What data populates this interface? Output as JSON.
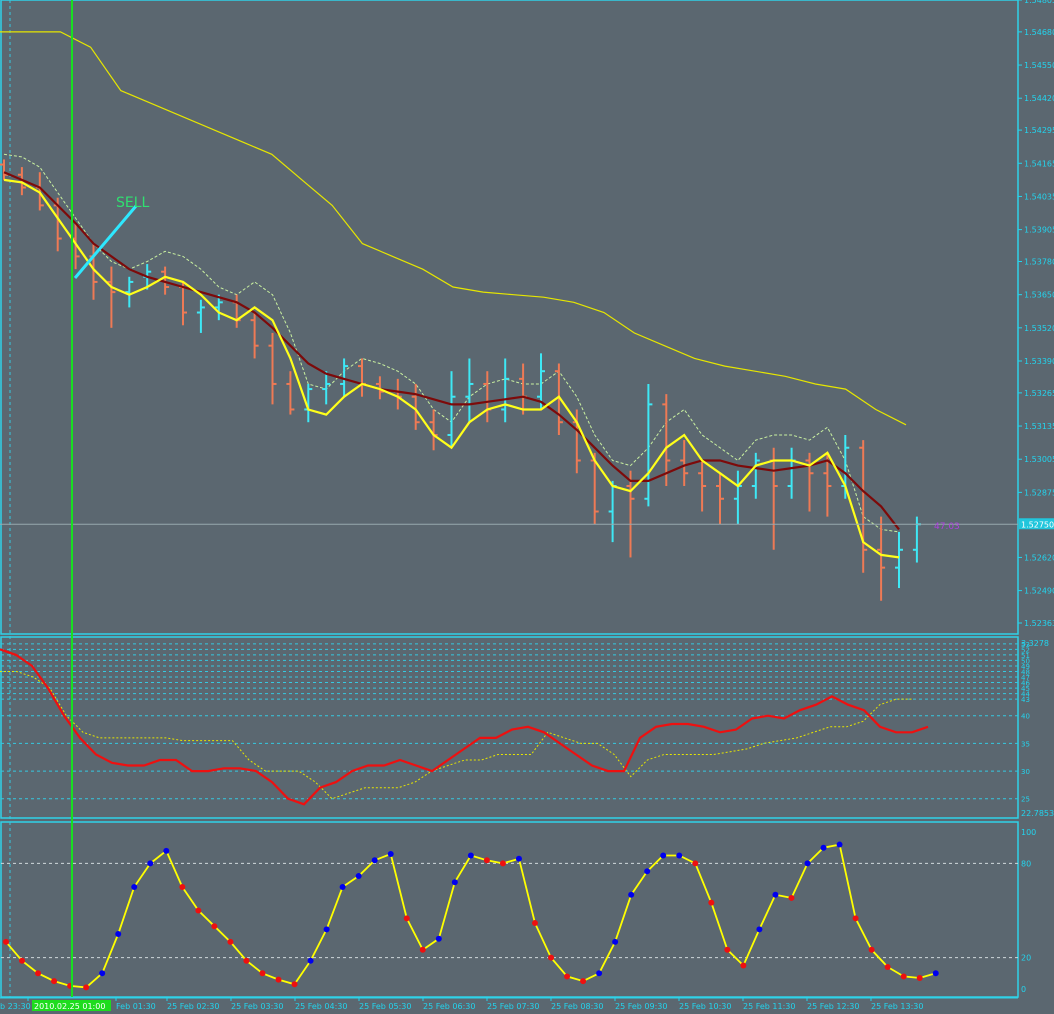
{
  "colors": {
    "background": "#5b6770",
    "panel_border": "#2fd2e8",
    "grid": "#35c8e0",
    "axis_text": "#23d4ee",
    "bull_bar": "#3ee8f5",
    "bear_bar": "#ee7a55",
    "fast_ma": "#ffff1a",
    "slow_ma": "#7d0a0a",
    "band": "#e6e600",
    "band_dotted": "#c9f0a0",
    "signal_text": "#30e070",
    "signal_line": "#2ee8ff",
    "cursor_line": "#18e020",
    "price_line": "#98a8ae",
    "price_label_bg": "#21c6dc",
    "adx_main": "#ee1010",
    "adx_dotted": "#e6e600",
    "stoch_line": "#ffff00",
    "stoch_dot_up": "#0000ee",
    "stoch_dot_down": "#ee1010",
    "time_highlight_bg": "#1edc1e",
    "annotation": "#b040e0"
  },
  "signal": {
    "label": "SELL"
  },
  "current_price": {
    "label": "1.52750",
    "annotation": "47.03"
  },
  "price_axis": {
    "ticks": [
      "1.54805",
      "1.54680",
      "1.54550",
      "1.54420",
      "1.54295",
      "1.54165",
      "1.54035",
      "1.53905",
      "1.53780",
      "1.53650",
      "1.53520",
      "1.53390",
      "1.53265",
      "1.53135",
      "1.53005",
      "1.52875",
      "1.52620",
      "1.52490",
      "1.52363"
    ]
  },
  "adx_axis": {
    "top_label": "3.3278",
    "ticks": [
      "53",
      "52",
      "51",
      "50",
      "49",
      "48",
      "47",
      "46",
      "45",
      "44",
      "43",
      "40",
      "35",
      "30",
      "25"
    ],
    "bottom_label": "22.7853"
  },
  "stoch_axis": {
    "ticks": [
      "100",
      "80",
      "20",
      "0"
    ]
  },
  "time_axis": {
    "highlight": "2010.02.25 01:00",
    "labels": [
      "b 23:30",
      "Feb 01:30",
      "25 Feb 02:30",
      "25 Feb 03:30",
      "25 Feb 04:30",
      "25 Feb 05:30",
      "25 Feb 06:30",
      "25 Feb 07:30",
      "25 Feb 08:30",
      "25 Feb 09:30",
      "25 Feb 10:30",
      "25 Feb 11:30",
      "25 Feb 12:30",
      "25 Feb 13:30"
    ]
  },
  "chart_data": [
    {
      "type": "line",
      "title": "Price",
      "ylim": [
        1.52363,
        1.54805
      ],
      "series": [
        {
          "values": [
            1.541,
            1.5409,
            1.5405,
            1.5395,
            1.5385,
            1.5375,
            1.5368,
            1.5365,
            1.5368,
            1.5372,
            1.537,
            1.5365,
            1.5358,
            1.5355,
            1.536,
            1.5355,
            1.534,
            1.532,
            1.5318,
            1.5325,
            1.533,
            1.5328,
            1.5325,
            1.532,
            1.531,
            1.5305,
            1.5315,
            1.532,
            1.5322,
            1.532,
            1.532,
            1.5325,
            1.5315,
            1.53,
            1.529,
            1.5288,
            1.5295,
            1.5305,
            1.531,
            1.53,
            1.5295,
            1.529,
            1.5298,
            1.53,
            1.53,
            1.5298,
            1.5303,
            1.529,
            1.5268,
            1.5263,
            1.5262
          ]
        },
        {
          "values": [
            1.5413,
            1.541,
            1.5407,
            1.54,
            1.5393,
            1.5385,
            1.538,
            1.5375,
            1.5372,
            1.537,
            1.5368,
            1.5366,
            1.5364,
            1.5362,
            1.5358,
            1.5352,
            1.5345,
            1.5338,
            1.5334,
            1.5332,
            1.533,
            1.5328,
            1.5327,
            1.5326,
            1.5324,
            1.5322,
            1.5322,
            1.5323,
            1.5324,
            1.5325,
            1.5323,
            1.5318,
            1.5312,
            1.5305,
            1.5298,
            1.5292,
            1.5292,
            1.5295,
            1.5298,
            1.53,
            1.53,
            1.5298,
            1.5297,
            1.5296,
            1.5297,
            1.5298,
            1.53,
            1.5295,
            1.5288,
            1.5282,
            1.5273
          ]
        },
        {
          "values": [
            1.5468,
            1.5468,
            1.5468,
            1.5462,
            1.5445,
            1.544,
            1.5435,
            1.543,
            1.5425,
            1.542,
            1.541,
            1.54,
            1.5385,
            1.538,
            1.5375,
            1.5368,
            1.5366,
            1.5365,
            1.5364,
            1.5362,
            1.5358,
            1.535,
            1.5345,
            1.534,
            1.5337,
            1.5335,
            1.5333,
            1.533,
            1.5328,
            1.532,
            1.5314
          ]
        }
      ],
      "bars": [
        [
          1.5416,
          1.5418,
          1.541,
          1.5412
        ],
        [
          1.5412,
          1.5415,
          1.5404,
          1.5407
        ],
        [
          1.5407,
          1.5413,
          1.5398,
          1.54
        ],
        [
          1.54,
          1.5403,
          1.5382,
          1.5387
        ],
        [
          1.5387,
          1.5393,
          1.5375,
          1.538
        ],
        [
          1.538,
          1.5385,
          1.5363,
          1.537
        ],
        [
          1.537,
          1.5376,
          1.5352,
          1.5366
        ],
        [
          1.5366,
          1.5372,
          1.536,
          1.537
        ],
        [
          1.5372,
          1.5377,
          1.5367,
          1.5374
        ],
        [
          1.5374,
          1.5376,
          1.5365,
          1.5368
        ],
        [
          1.5368,
          1.537,
          1.5353,
          1.5358
        ],
        [
          1.5358,
          1.5363,
          1.535,
          1.536
        ],
        [
          1.536,
          1.5365,
          1.5355,
          1.5362
        ],
        [
          1.5362,
          1.5365,
          1.5352,
          1.5355
        ],
        [
          1.5355,
          1.5358,
          1.534,
          1.5345
        ],
        [
          1.5345,
          1.535,
          1.5322,
          1.533
        ],
        [
          1.533,
          1.5335,
          1.5318,
          1.532
        ],
        [
          1.532,
          1.533,
          1.5315,
          1.5328
        ],
        [
          1.5328,
          1.5335,
          1.5322,
          1.533
        ],
        [
          1.533,
          1.534,
          1.5325,
          1.5337
        ],
        [
          1.5337,
          1.534,
          1.5325,
          1.533
        ],
        [
          1.533,
          1.5333,
          1.5324,
          1.5327
        ],
        [
          1.5327,
          1.5332,
          1.532,
          1.5325
        ],
        [
          1.5325,
          1.533,
          1.5312,
          1.5315
        ],
        [
          1.5315,
          1.532,
          1.5304,
          1.531
        ],
        [
          1.531,
          1.5335,
          1.5305,
          1.5325
        ],
        [
          1.5325,
          1.534,
          1.5315,
          1.533
        ],
        [
          1.533,
          1.5335,
          1.5315,
          1.532
        ],
        [
          1.532,
          1.534,
          1.5315,
          1.5332
        ],
        [
          1.5332,
          1.5338,
          1.5318,
          1.5325
        ],
        [
          1.5325,
          1.5342,
          1.532,
          1.5335
        ],
        [
          1.5335,
          1.5338,
          1.531,
          1.5315
        ],
        [
          1.5315,
          1.532,
          1.5295,
          1.53
        ],
        [
          1.53,
          1.5303,
          1.5275,
          1.528
        ],
        [
          1.528,
          1.5292,
          1.5268,
          1.529
        ],
        [
          1.529,
          1.5296,
          1.5262,
          1.5285
        ],
        [
          1.5285,
          1.533,
          1.5282,
          1.5322
        ],
        [
          1.5322,
          1.5326,
          1.529,
          1.53
        ],
        [
          1.53,
          1.5308,
          1.529,
          1.5295
        ],
        [
          1.5295,
          1.53,
          1.528,
          1.529
        ],
        [
          1.529,
          1.5295,
          1.5275,
          1.5285
        ],
        [
          1.5285,
          1.5296,
          1.5275,
          1.529
        ],
        [
          1.529,
          1.5303,
          1.5285,
          1.53
        ],
        [
          1.53,
          1.5305,
          1.5265,
          1.529
        ],
        [
          1.529,
          1.5305,
          1.5285,
          1.53
        ],
        [
          1.53,
          1.5303,
          1.528,
          1.5295
        ],
        [
          1.5295,
          1.5303,
          1.5278,
          1.529
        ],
        [
          1.529,
          1.531,
          1.5285,
          1.5305
        ],
        [
          1.5305,
          1.5308,
          1.5256,
          1.5265
        ],
        [
          1.5265,
          1.5278,
          1.5245,
          1.5258
        ],
        [
          1.5258,
          1.5272,
          1.525,
          1.5265
        ],
        [
          1.5265,
          1.5278,
          1.526,
          1.5275
        ]
      ]
    },
    {
      "type": "line",
      "title": "ADX",
      "ylim": [
        22.7853,
        53.3278
      ],
      "series": [
        {
          "values": [
            52,
            51,
            49,
            45,
            40,
            36,
            33,
            31.5,
            31,
            31,
            32,
            32,
            30,
            30,
            30.5,
            30.5,
            30,
            28,
            25,
            24,
            27,
            28,
            30,
            31,
            31,
            32,
            31,
            30,
            32,
            34,
            36,
            36,
            37.5,
            38,
            37,
            35,
            33,
            31,
            30,
            30,
            36,
            38,
            38.5,
            38.5,
            38,
            37,
            37.5,
            39.5,
            40,
            39.5,
            41,
            42,
            43.5,
            42,
            41,
            38,
            37,
            37,
            38
          ]
        },
        {
          "values": [
            48,
            48,
            47,
            45,
            40,
            37,
            36,
            36,
            36,
            36,
            36,
            35.5,
            35.5,
            35.5,
            35.5,
            32,
            30,
            30,
            30,
            28,
            25,
            26,
            27,
            27,
            27,
            28,
            30,
            31,
            32,
            32,
            33,
            33,
            33,
            37,
            36,
            35,
            35,
            33,
            29,
            32,
            33,
            33,
            33,
            33,
            33.5,
            34,
            35,
            35.5,
            36,
            37,
            38,
            38,
            39,
            42,
            43,
            43
          ]
        }
      ]
    },
    {
      "type": "line",
      "title": "Stochastic",
      "ylim": [
        0,
        100
      ],
      "series": [
        {
          "values": [
            30,
            18,
            10,
            5,
            2,
            1,
            10,
            35,
            65,
            80,
            88,
            65,
            50,
            40,
            30,
            18,
            10,
            6,
            3,
            18,
            38,
            65,
            72,
            82,
            86,
            45,
            25,
            32,
            68,
            85,
            82,
            80,
            83,
            42,
            20,
            8,
            5,
            10,
            30,
            60,
            75,
            85,
            85,
            80,
            55,
            25,
            15,
            38,
            60,
            58,
            80,
            90,
            92,
            45,
            25,
            14,
            8,
            7,
            10
          ]
        }
      ]
    }
  ]
}
